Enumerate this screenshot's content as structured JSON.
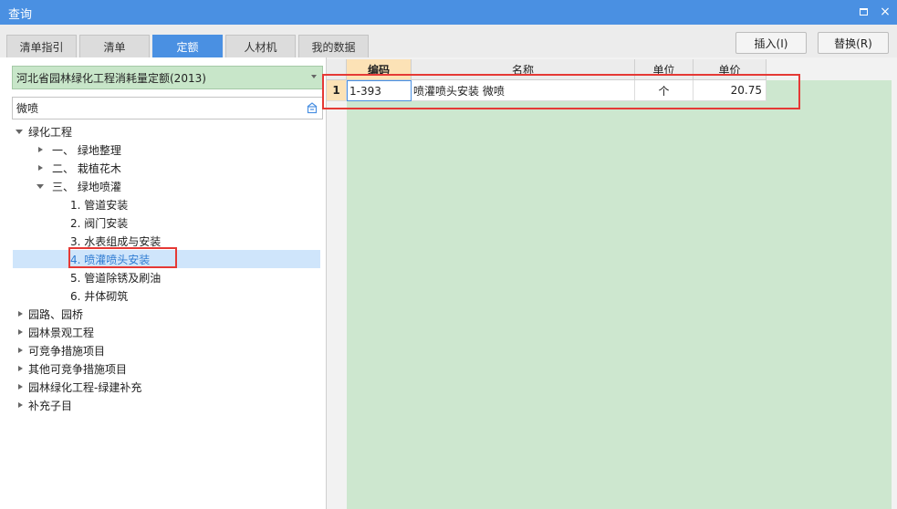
{
  "window": {
    "title": "查询",
    "maximize_label": "□",
    "close_label": "×"
  },
  "tabs": [
    {
      "label": "清单指引",
      "active": false
    },
    {
      "label": "清单",
      "active": false
    },
    {
      "label": "定额",
      "active": true
    },
    {
      "label": "人材机",
      "active": false
    },
    {
      "label": "我的数据",
      "active": false
    }
  ],
  "buttons": {
    "insert": "插入(I)",
    "replace": "替换(R)"
  },
  "library": {
    "selected": "河北省园林绿化工程消耗量定额(2013)"
  },
  "search": {
    "value": "微喷",
    "placeholder": ""
  },
  "tree": [
    {
      "label": "绿化工程",
      "expanded": true
    },
    {
      "label": "一、 绿地整理",
      "expanded": false
    },
    {
      "label": "二、 栽植花木",
      "expanded": false
    },
    {
      "label": "三、 绿地喷灌",
      "expanded": true
    },
    {
      "label": "1. 管道安装"
    },
    {
      "label": "2. 阀门安装"
    },
    {
      "label": "3. 水表组成与安装"
    },
    {
      "label": "4. 喷灌喷头安装",
      "selected": true
    },
    {
      "label": "5. 管道除锈及刷油"
    },
    {
      "label": "6. 井体砌筑"
    },
    {
      "label": "园路、园桥",
      "expanded": false
    },
    {
      "label": "园林景观工程",
      "expanded": false
    },
    {
      "label": "可竞争措施项目",
      "expanded": false
    },
    {
      "label": "其他可竞争措施项目",
      "expanded": false
    },
    {
      "label": "园林绿化工程-绿建补充",
      "expanded": false
    },
    {
      "label": "补充子目",
      "expanded": false
    }
  ],
  "grid": {
    "columns": [
      "编码",
      "名称",
      "单位",
      "单价"
    ],
    "rows": [
      {
        "num": "1",
        "code": "1-393",
        "name": "喷灌喷头安装 微喷",
        "unit": "个",
        "price": "20.75"
      }
    ]
  },
  "colors": {
    "accent": "#4a90e2",
    "highlight": "#e53935",
    "green": "#cde7cf",
    "header_hl": "#fce2b6"
  }
}
